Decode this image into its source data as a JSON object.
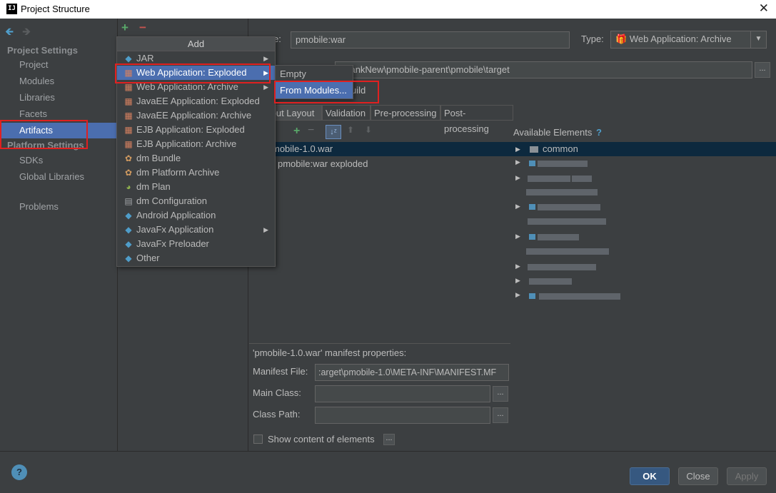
{
  "window": {
    "title": "Project Structure",
    "logo_text": "IJ",
    "close_glyph": "✕"
  },
  "left_panel": {
    "back_arrow": "🡸",
    "forward_arrow": "🡺",
    "project_settings_header": "Project Settings",
    "project_settings": [
      "Project",
      "Modules",
      "Libraries",
      "Facets",
      "Artifacts"
    ],
    "selected": "Artifacts",
    "platform_settings_header": "Platform Settings",
    "platform_settings": [
      "SDKs",
      "Global Libraries"
    ],
    "other": [
      "Problems"
    ]
  },
  "toolbar": {
    "add_glyph": "+",
    "remove_glyph": "−"
  },
  "artifact_form": {
    "name_label_fragment": "e:",
    "name_value": "pmobile:war",
    "type_label": "Type:",
    "type_value": "Web Application: Archive",
    "output_dir_value": "ebankNew\\pmobile-parent\\pmobile\\target",
    "include_build_fragment": "uild",
    "browse_label": "...",
    "tabs": [
      "tput Layout",
      "Validation",
      "Pre-processing",
      "Post-processing"
    ],
    "active_tab": "tput Layout",
    "layout_tree": [
      "mobile-1.0.war",
      "pmobile:war exploded"
    ],
    "available_elements_label": "Available Elements",
    "available_help": "?",
    "available_first": "common",
    "manifest_header": "'pmobile-1.0.war' manifest properties:",
    "manifest_file_label": "Manifest File:",
    "manifest_file_value": ":arget\\pmobile-1.0\\META-INF\\MANIFEST.MF",
    "main_class_label": "Main Class:",
    "class_path_label": "Class Path:",
    "show_content_label": "Show content of elements"
  },
  "add_menu": {
    "header": "Add",
    "items": [
      {
        "label": "JAR",
        "icon": "diamond-icon",
        "submenu": true
      },
      {
        "label": "Web Application: Exploded",
        "icon": "gift-icon",
        "submenu": true,
        "highlighted": true
      },
      {
        "label": "Web Application: Archive",
        "icon": "gift-icon",
        "submenu": true
      },
      {
        "label": "JavaEE Application: Exploded",
        "icon": "gift-icon",
        "submenu": false
      },
      {
        "label": "JavaEE Application: Archive",
        "icon": "gift-icon",
        "submenu": false
      },
      {
        "label": "EJB Application: Exploded",
        "icon": "gift-icon",
        "submenu": false
      },
      {
        "label": "EJB Application: Archive",
        "icon": "gift-icon",
        "submenu": false
      },
      {
        "label": "dm Bundle",
        "icon": "bundle-icon",
        "submenu": false
      },
      {
        "label": "dm Platform Archive",
        "icon": "bundle-icon",
        "submenu": false
      },
      {
        "label": "dm Plan",
        "icon": "globe-icon",
        "submenu": false
      },
      {
        "label": "dm Configuration",
        "icon": "document-icon",
        "submenu": false
      },
      {
        "label": "Android Application",
        "icon": "diamond-icon",
        "submenu": false
      },
      {
        "label": "JavaFx Application",
        "icon": "diamond-icon",
        "submenu": true
      },
      {
        "label": "JavaFx Preloader",
        "icon": "diamond-icon",
        "submenu": false
      },
      {
        "label": "Other",
        "icon": "diamond-icon",
        "submenu": false
      }
    ]
  },
  "sub_menu": {
    "items": [
      "Empty",
      "From Modules..."
    ],
    "highlighted": "From Modules..."
  },
  "bottom": {
    "help_glyph": "?",
    "ok_label": "OK",
    "close_label": "Close",
    "apply_label": "Apply"
  },
  "colors": {
    "background": "#3c3f41",
    "selection": "#4b6eaf",
    "annotation_red": "#e02020"
  }
}
